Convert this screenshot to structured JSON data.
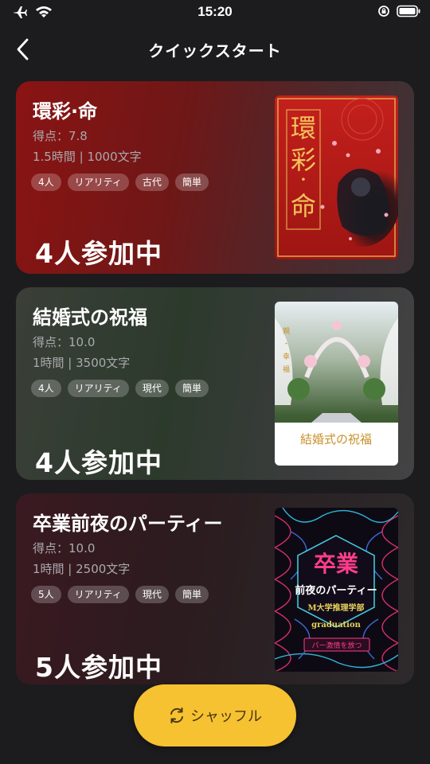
{
  "status_bar": {
    "time": "15:20",
    "icons": [
      "airplane-icon",
      "wifi-icon",
      "orientation-lock-icon",
      "battery-icon"
    ]
  },
  "header": {
    "title": "クイックスタート",
    "back_icon": "chevron-left-icon"
  },
  "cards": [
    {
      "title": "環彩·命",
      "score": "得点：7.8",
      "meta": "1.5時間 | 1000文字",
      "tags": [
        "4人",
        "リアリティ",
        "古代",
        "簡単"
      ],
      "players": "4人参加中",
      "cover_text": [
        "環",
        "彩",
        "·",
        "命"
      ]
    },
    {
      "title": "結婚式の祝福",
      "score": "得点：10.0",
      "meta": "1時間 | 3500文字",
      "tags": [
        "4人",
        "リアリティ",
        "現代",
        "簡単"
      ],
      "players": "4人参加中",
      "cover_text": [
        "結婚式の祝福"
      ]
    },
    {
      "title": "卒業前夜のパーティー",
      "score": "得点：10.0",
      "meta": "1時間 | 2500文字",
      "tags": [
        "5人",
        "リアリティ",
        "現代",
        "簡単"
      ],
      "players": "5人参加中",
      "cover_text": [
        "卒業",
        "前夜のパーティー",
        "M大学推理学部",
        "graduation",
        "パー激情を放つ"
      ]
    }
  ],
  "shuffle_button": {
    "label": "シャッフル",
    "icon": "refresh-icon"
  },
  "colors": {
    "accent": "#f6c232",
    "background": "#1c1c1e"
  }
}
